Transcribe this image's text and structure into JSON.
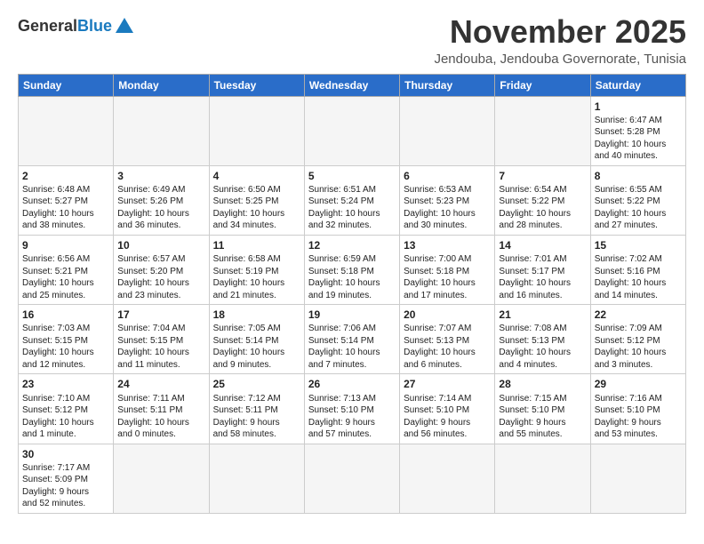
{
  "header": {
    "logo_general": "General",
    "logo_blue": "Blue",
    "month_title": "November 2025",
    "location": "Jendouba, Jendouba Governorate, Tunisia"
  },
  "weekdays": [
    "Sunday",
    "Monday",
    "Tuesday",
    "Wednesday",
    "Thursday",
    "Friday",
    "Saturday"
  ],
  "weeks": [
    [
      {
        "day": "",
        "info": ""
      },
      {
        "day": "",
        "info": ""
      },
      {
        "day": "",
        "info": ""
      },
      {
        "day": "",
        "info": ""
      },
      {
        "day": "",
        "info": ""
      },
      {
        "day": "",
        "info": ""
      },
      {
        "day": "1",
        "info": "Sunrise: 6:47 AM\nSunset: 5:28 PM\nDaylight: 10 hours\nand 40 minutes."
      }
    ],
    [
      {
        "day": "2",
        "info": "Sunrise: 6:48 AM\nSunset: 5:27 PM\nDaylight: 10 hours\nand 38 minutes."
      },
      {
        "day": "3",
        "info": "Sunrise: 6:49 AM\nSunset: 5:26 PM\nDaylight: 10 hours\nand 36 minutes."
      },
      {
        "day": "4",
        "info": "Sunrise: 6:50 AM\nSunset: 5:25 PM\nDaylight: 10 hours\nand 34 minutes."
      },
      {
        "day": "5",
        "info": "Sunrise: 6:51 AM\nSunset: 5:24 PM\nDaylight: 10 hours\nand 32 minutes."
      },
      {
        "day": "6",
        "info": "Sunrise: 6:53 AM\nSunset: 5:23 PM\nDaylight: 10 hours\nand 30 minutes."
      },
      {
        "day": "7",
        "info": "Sunrise: 6:54 AM\nSunset: 5:22 PM\nDaylight: 10 hours\nand 28 minutes."
      },
      {
        "day": "8",
        "info": "Sunrise: 6:55 AM\nSunset: 5:22 PM\nDaylight: 10 hours\nand 27 minutes."
      }
    ],
    [
      {
        "day": "9",
        "info": "Sunrise: 6:56 AM\nSunset: 5:21 PM\nDaylight: 10 hours\nand 25 minutes."
      },
      {
        "day": "10",
        "info": "Sunrise: 6:57 AM\nSunset: 5:20 PM\nDaylight: 10 hours\nand 23 minutes."
      },
      {
        "day": "11",
        "info": "Sunrise: 6:58 AM\nSunset: 5:19 PM\nDaylight: 10 hours\nand 21 minutes."
      },
      {
        "day": "12",
        "info": "Sunrise: 6:59 AM\nSunset: 5:18 PM\nDaylight: 10 hours\nand 19 minutes."
      },
      {
        "day": "13",
        "info": "Sunrise: 7:00 AM\nSunset: 5:18 PM\nDaylight: 10 hours\nand 17 minutes."
      },
      {
        "day": "14",
        "info": "Sunrise: 7:01 AM\nSunset: 5:17 PM\nDaylight: 10 hours\nand 16 minutes."
      },
      {
        "day": "15",
        "info": "Sunrise: 7:02 AM\nSunset: 5:16 PM\nDaylight: 10 hours\nand 14 minutes."
      }
    ],
    [
      {
        "day": "16",
        "info": "Sunrise: 7:03 AM\nSunset: 5:15 PM\nDaylight: 10 hours\nand 12 minutes."
      },
      {
        "day": "17",
        "info": "Sunrise: 7:04 AM\nSunset: 5:15 PM\nDaylight: 10 hours\nand 11 minutes."
      },
      {
        "day": "18",
        "info": "Sunrise: 7:05 AM\nSunset: 5:14 PM\nDaylight: 10 hours\nand 9 minutes."
      },
      {
        "day": "19",
        "info": "Sunrise: 7:06 AM\nSunset: 5:14 PM\nDaylight: 10 hours\nand 7 minutes."
      },
      {
        "day": "20",
        "info": "Sunrise: 7:07 AM\nSunset: 5:13 PM\nDaylight: 10 hours\nand 6 minutes."
      },
      {
        "day": "21",
        "info": "Sunrise: 7:08 AM\nSunset: 5:13 PM\nDaylight: 10 hours\nand 4 minutes."
      },
      {
        "day": "22",
        "info": "Sunrise: 7:09 AM\nSunset: 5:12 PM\nDaylight: 10 hours\nand 3 minutes."
      }
    ],
    [
      {
        "day": "23",
        "info": "Sunrise: 7:10 AM\nSunset: 5:12 PM\nDaylight: 10 hours\nand 1 minute."
      },
      {
        "day": "24",
        "info": "Sunrise: 7:11 AM\nSunset: 5:11 PM\nDaylight: 10 hours\nand 0 minutes."
      },
      {
        "day": "25",
        "info": "Sunrise: 7:12 AM\nSunset: 5:11 PM\nDaylight: 9 hours\nand 58 minutes."
      },
      {
        "day": "26",
        "info": "Sunrise: 7:13 AM\nSunset: 5:10 PM\nDaylight: 9 hours\nand 57 minutes."
      },
      {
        "day": "27",
        "info": "Sunrise: 7:14 AM\nSunset: 5:10 PM\nDaylight: 9 hours\nand 56 minutes."
      },
      {
        "day": "28",
        "info": "Sunrise: 7:15 AM\nSunset: 5:10 PM\nDaylight: 9 hours\nand 55 minutes."
      },
      {
        "day": "29",
        "info": "Sunrise: 7:16 AM\nSunset: 5:10 PM\nDaylight: 9 hours\nand 53 minutes."
      }
    ],
    [
      {
        "day": "30",
        "info": "Sunrise: 7:17 AM\nSunset: 5:09 PM\nDaylight: 9 hours\nand 52 minutes."
      },
      {
        "day": "",
        "info": ""
      },
      {
        "day": "",
        "info": ""
      },
      {
        "day": "",
        "info": ""
      },
      {
        "day": "",
        "info": ""
      },
      {
        "day": "",
        "info": ""
      },
      {
        "day": "",
        "info": ""
      }
    ]
  ]
}
